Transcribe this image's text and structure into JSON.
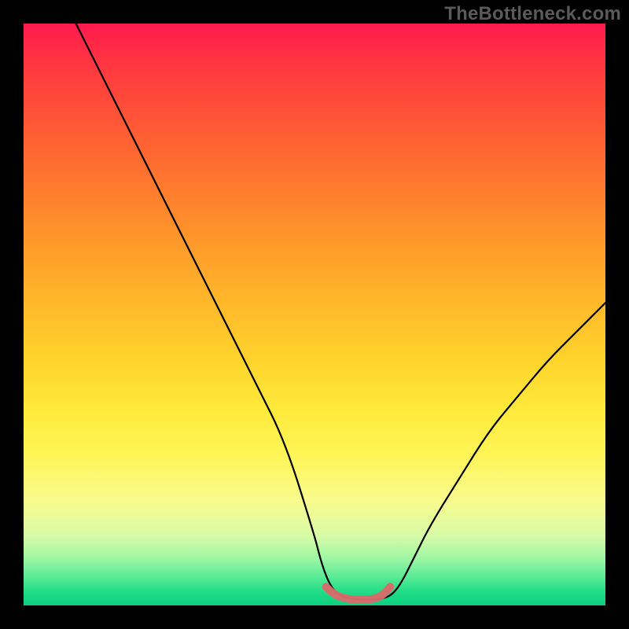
{
  "watermark": "TheBottleneck.com",
  "chart_data": {
    "type": "line",
    "title": "",
    "xlabel": "",
    "ylabel": "",
    "xlim": [
      0,
      100
    ],
    "ylim": [
      0,
      100
    ],
    "gradient_stops": [
      {
        "pos": 0,
        "color": "#ff1a4d"
      },
      {
        "pos": 50,
        "color": "#ffd42c"
      },
      {
        "pos": 82,
        "color": "#f9fb8e"
      },
      {
        "pos": 100,
        "color": "#0fd07f"
      }
    ],
    "series": [
      {
        "name": "bottleneck-curve",
        "color": "#000000",
        "x": [
          9.0,
          15,
          20,
          25,
          30,
          35,
          40,
          45,
          50,
          51,
          52,
          53,
          54,
          55,
          56,
          58,
          60,
          62,
          63.5,
          65,
          67,
          70,
          75,
          80,
          85,
          90,
          95,
          100
        ],
        "y": [
          100,
          88,
          78,
          68,
          58,
          48,
          38,
          28,
          12,
          8,
          5,
          3,
          2,
          1.5,
          1.2,
          1.0,
          1.0,
          1.2,
          2,
          4,
          8,
          14,
          22,
          30,
          36,
          42,
          47,
          52
        ]
      },
      {
        "name": "optimal-band",
        "color": "#d86a6a",
        "x": [
          52,
          53,
          54,
          55,
          56,
          57,
          58,
          59,
          60,
          61,
          62,
          63
        ],
        "y": [
          3.2,
          2.2,
          1.6,
          1.3,
          1.1,
          1.0,
          1.0,
          1.0,
          1.1,
          1.4,
          2.0,
          3.2
        ]
      }
    ],
    "dip_range_x": [
      52,
      63
    ]
  }
}
